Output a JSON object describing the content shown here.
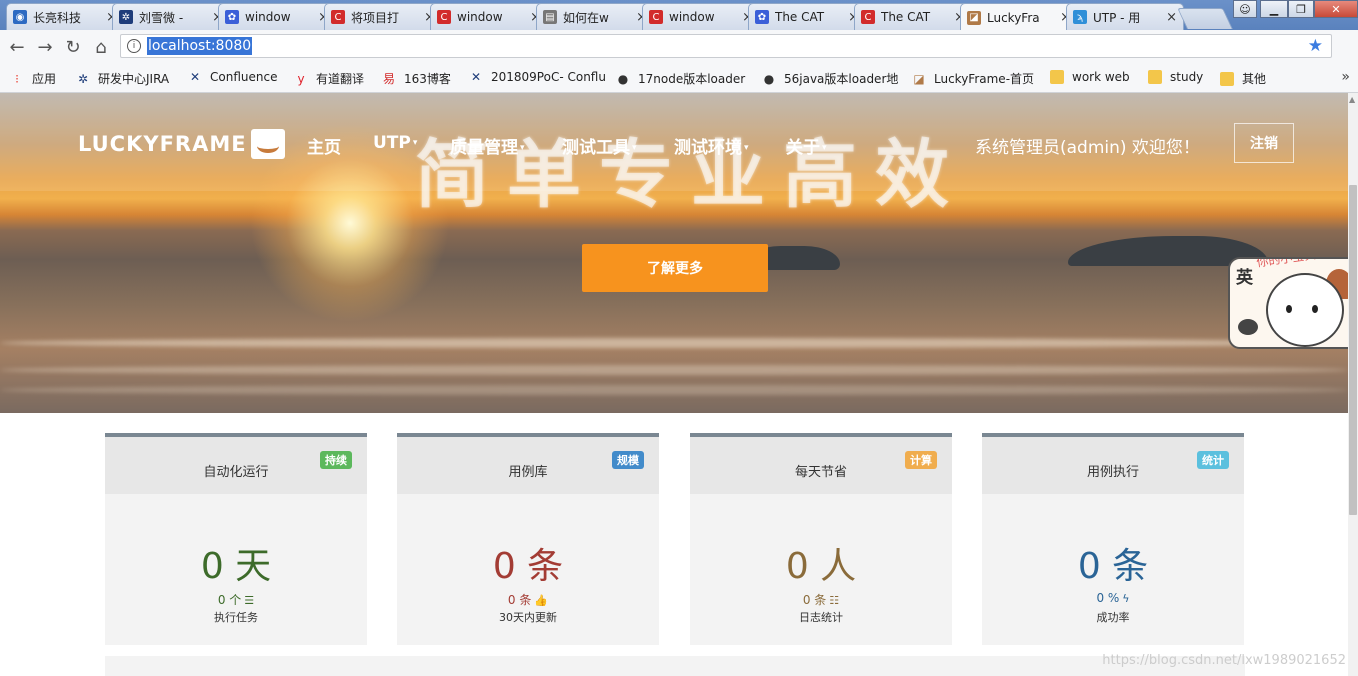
{
  "browser": {
    "tabs": [
      {
        "title": "长亮科技",
        "icon": "globe-icon",
        "color": "#2d6ac2",
        "active": false
      },
      {
        "title": "刘雪微 -",
        "icon": "jira-icon",
        "color": "#1f3d7a",
        "active": false
      },
      {
        "title": "window",
        "icon": "paw-icon",
        "color": "#3b5fd8",
        "active": false
      },
      {
        "title": "将项目打",
        "icon": "c-icon",
        "color": "#d22b2b",
        "active": false
      },
      {
        "title": "window",
        "icon": "c-icon",
        "color": "#d22b2b",
        "active": false
      },
      {
        "title": "如何在w",
        "icon": "page-icon",
        "color": "#777777",
        "active": false
      },
      {
        "title": "window",
        "icon": "c-icon",
        "color": "#d22b2b",
        "active": false
      },
      {
        "title": "The CAT",
        "icon": "paw-icon",
        "color": "#3b5fd8",
        "active": false
      },
      {
        "title": "The CAT",
        "icon": "c-icon",
        "color": "#d22b2b",
        "active": false
      },
      {
        "title": "LuckyFra",
        "icon": "luckyframe-icon",
        "color": "#b07a48",
        "active": true
      },
      {
        "title": "UTP - 用",
        "icon": "bird-icon",
        "color": "#2f8fd8",
        "active": false
      }
    ],
    "close_glyph": "×",
    "url": "localhost:8080",
    "bookmarks": [
      {
        "label": "应用",
        "icon": "apps-grid-icon",
        "color": "#e94235"
      },
      {
        "label": "研发中心JIRA",
        "icon": "jira-icon",
        "color": "#1f3d7a"
      },
      {
        "label": "Confluence",
        "icon": "confluence-icon",
        "color": "#1f3d7a"
      },
      {
        "label": "有道翻译",
        "icon": "youdao-icon",
        "color": "#e0232c"
      },
      {
        "label": "163博客",
        "icon": "netease-icon",
        "color": "#d22b2b"
      },
      {
        "label": "201809PoC- Conflu",
        "icon": "confluence-icon",
        "color": "#1f3d7a"
      },
      {
        "label": "17node版本loader",
        "icon": "github-icon",
        "color": "#333333"
      },
      {
        "label": "56java版本loader地",
        "icon": "github-icon",
        "color": "#333333"
      },
      {
        "label": "LuckyFrame-首页",
        "icon": "luckyframe-icon",
        "color": "#b07a48"
      },
      {
        "label": "work web",
        "icon": "folder-icon",
        "color": "#f3c64a"
      },
      {
        "label": "study",
        "icon": "folder-icon",
        "color": "#f3c64a"
      },
      {
        "label": "其他",
        "icon": "folder-icon",
        "color": "#f3c64a"
      }
    ]
  },
  "site": {
    "logo_text": "LUCKYFRAME",
    "nav": [
      {
        "label": "主页",
        "dropdown": false
      },
      {
        "label": "UTP",
        "dropdown": true
      },
      {
        "label": "质量管理",
        "dropdown": true
      },
      {
        "label": "测试工具",
        "dropdown": true
      },
      {
        "label": "测试环境",
        "dropdown": true
      },
      {
        "label": "关于",
        "dropdown": true
      }
    ],
    "welcome": "系统管理员(admin)  欢迎您！",
    "logout": "注销",
    "slogan": "简单专业高效",
    "learn_more": "了解更多",
    "mascot": {
      "lang": "英",
      "caption": "你的小宝贝上线了"
    },
    "accent_color": "#f7931e"
  },
  "cards": [
    {
      "title": "自动化运行",
      "badge": "持续",
      "badge_color": "#5cb85c",
      "big": "0 天",
      "big_color": "#3d6b2a",
      "small": "0 个",
      "small_color": "#3d6b2a",
      "small_icon": "list-icon",
      "small_glyph": "☰",
      "caption": "执行任务"
    },
    {
      "title": "用例库",
      "badge": "规模",
      "badge_color": "#428bca",
      "big": "0 条",
      "big_color": "#a33c34",
      "small": "0 条",
      "small_color": "#a33c34",
      "small_icon": "thumbs-up-icon",
      "small_glyph": "👍",
      "caption": "30天内更新"
    },
    {
      "title": "每天节省",
      "badge": "计算",
      "badge_color": "#f0ad4e",
      "big": "0 人",
      "big_color": "#8a6b3a",
      "small": "0 条",
      "small_color": "#8a6b3a",
      "small_icon": "list-ordered-icon",
      "small_glyph": "☷",
      "caption": "日志统计"
    },
    {
      "title": "用例执行",
      "badge": "统计",
      "badge_color": "#5bc0de",
      "big": "0 条",
      "big_color": "#2a6496",
      "small": "0 %",
      "small_color": "#2a6496",
      "small_icon": "bolt-icon",
      "small_glyph": "ϟ",
      "caption": "成功率"
    }
  ],
  "watermark": "https://blog.csdn.net/lxw1989021652"
}
